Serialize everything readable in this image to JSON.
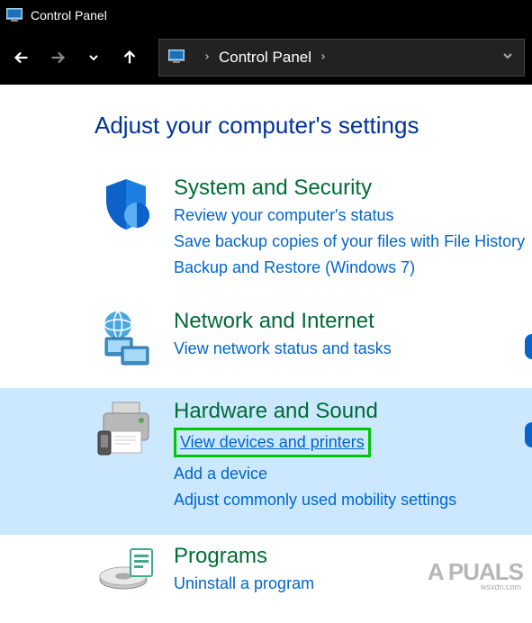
{
  "titlebar": {
    "title": "Control Panel"
  },
  "address": {
    "location": "Control Panel"
  },
  "heading": "Adjust your computer's settings",
  "categories": [
    {
      "title": "System and Security",
      "links": [
        "Review your computer's status",
        "Save backup copies of your files with File History",
        "Backup and Restore (Windows 7)"
      ]
    },
    {
      "title": "Network and Internet",
      "links": [
        "View network status and tasks"
      ]
    },
    {
      "title": "Hardware and Sound",
      "links": [
        "View devices and printers",
        "Add a device",
        "Adjust commonly used mobility settings"
      ]
    },
    {
      "title": "Programs",
      "links": [
        "Uninstall a program"
      ]
    }
  ],
  "watermark": {
    "brand": "A  PUALS",
    "site": "wsxdn.com"
  }
}
